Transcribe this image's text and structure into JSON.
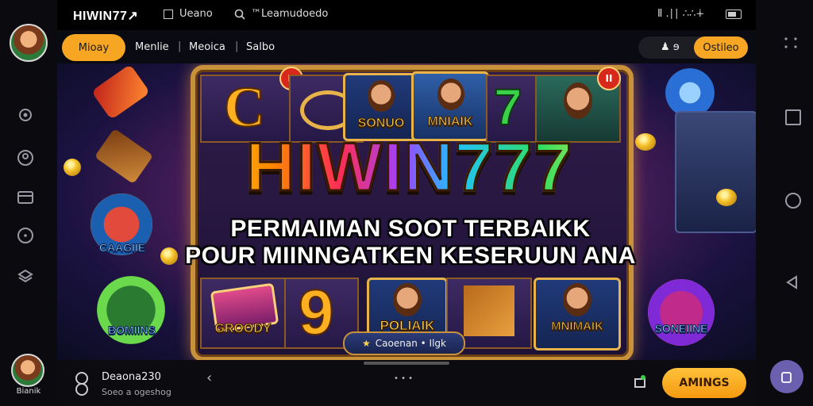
{
  "status_bar": {
    "app_title": "HIWIN77↗",
    "tab_label": "Ueano",
    "search_text": "™Leamudoedo",
    "status_right": "Ⅱ  .∣∣  ∴∴∔"
  },
  "nav": {
    "active_pill": "Mioay",
    "links": [
      "Menlie",
      "Meoica",
      "Salbo"
    ],
    "separator": "|",
    "right_button": "Ostileo",
    "user_symbol": "♟ ɘ"
  },
  "banner": {
    "title": "HIWIN777",
    "subtitle_line1": "PERMAIMAN SOOT TERBAIKK",
    "subtitle_line2": "POUR MIINNGATKEN KESERUUN ANA",
    "top_reel": {
      "letter": "C",
      "card1_label": "SONUO",
      "card2_label": "MNIAIK",
      "number": "7"
    },
    "bottom_reel": {
      "card1_label": "GROODY",
      "number": "9",
      "card2_label": "POLIAIK",
      "card3_label": "MNIMAIK",
      "center_badge": "Caoenan • Ilgk",
      "star_symbol": "★"
    },
    "side_badges": {
      "left_top": "CAAGIIE",
      "left_bottom": "BOMIINS",
      "right_bottom": "SONEIINE"
    },
    "pause_symbol": "II"
  },
  "bottom_bar": {
    "user_name": "Deaona230",
    "user_sub": "Soeo a ogeshog",
    "back_symbol": "‹",
    "dots": "• • •",
    "cta_label": "AMINGS",
    "left_avatar_label": "Bianik"
  },
  "colors": {
    "accent_orange": "#f7a623",
    "gold_frame": "#c8913a",
    "title_gradient": [
      "#ffd700",
      "#ff2d55",
      "#a040ff",
      "#20c0ff",
      "#30e060"
    ]
  }
}
